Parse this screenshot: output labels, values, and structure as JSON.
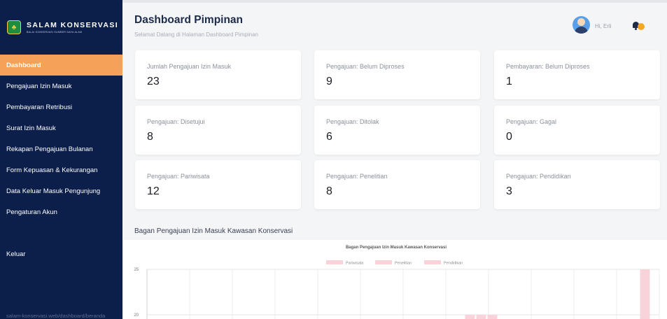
{
  "sidebar": {
    "brand_title": "SALAM KONSERVASI",
    "brand_subtitle": "BALAI KONSERVASI SUMBER DAYA ALAM",
    "brand_emblem_glyph": "♣",
    "items": [
      {
        "label": "Dashboard",
        "active": true
      },
      {
        "label": "Pengajuan Izin Masuk"
      },
      {
        "label": "Pembayaran Retribusi"
      },
      {
        "label": "Surat Izin Masuk"
      },
      {
        "label": "Rekapan Pengajuan Bulanan"
      },
      {
        "label": "Form Kepuasan & Kekurangan"
      },
      {
        "label": "Data Keluar Masuk Pengunjung"
      },
      {
        "label": "Pengaturan Akun"
      }
    ],
    "logout_label": "Keluar",
    "footer_text": "salam-konservasi.web/dashboard/beranda"
  },
  "header": {
    "title": "Dashboard Pimpinan",
    "subtitle": "Selamat Datang di Halaman Dashboard Pimpinan",
    "greeting": "Hi, Erli",
    "avatar_icon": "user-avatar-icon",
    "notification_icon": "bell-icon"
  },
  "cards": [
    {
      "label": "Jumlah Pengajuan Izin Masuk",
      "value": "23"
    },
    {
      "label": "Pengajuan: Belum Diproses",
      "value": "9"
    },
    {
      "label": "Pembayaran: Belum Diproses",
      "value": "1"
    },
    {
      "label": "Pengajuan: Disetujui",
      "value": "8"
    },
    {
      "label": "Pengajuan: Ditolak",
      "value": "6"
    },
    {
      "label": "Pengajuan: Gagal",
      "value": "0"
    },
    {
      "label": "Pengajuan: Pariwisata",
      "value": "12"
    },
    {
      "label": "Pengajuan: Penelitian",
      "value": "8"
    },
    {
      "label": "Pengajuan: Pendidikan",
      "value": "3"
    }
  ],
  "chart_section_title": "Bagan Pengajuan Izin Masuk Kawasan Konservasi",
  "colors": {
    "sidebar_bg": "#0b1f4a",
    "active_item": "#f5a15a",
    "bar_fill": "#f8d3da",
    "notification_badge": "#f5a623"
  },
  "chart_data": {
    "type": "bar",
    "title": "Bagan Pengajuan Izin Masuk Kawasan Konservasi",
    "legend": [
      "Pariwisata",
      "Penelitian",
      "Pendidikan"
    ],
    "legend_placement": "top",
    "y_ticks": [
      "25",
      "20"
    ],
    "ylim": [
      0,
      25
    ],
    "grid": true,
    "visible_bars": [
      {
        "category_index": 7,
        "series": "Pariwisata",
        "value": 20
      },
      {
        "category_index": 7,
        "series": "Penelitian",
        "value": 20
      },
      {
        "category_index": 7,
        "series": "Pendidikan",
        "value": 20
      },
      {
        "category_index": 11,
        "series": "Pariwisata",
        "value": 25
      }
    ],
    "category_count": 12
  }
}
